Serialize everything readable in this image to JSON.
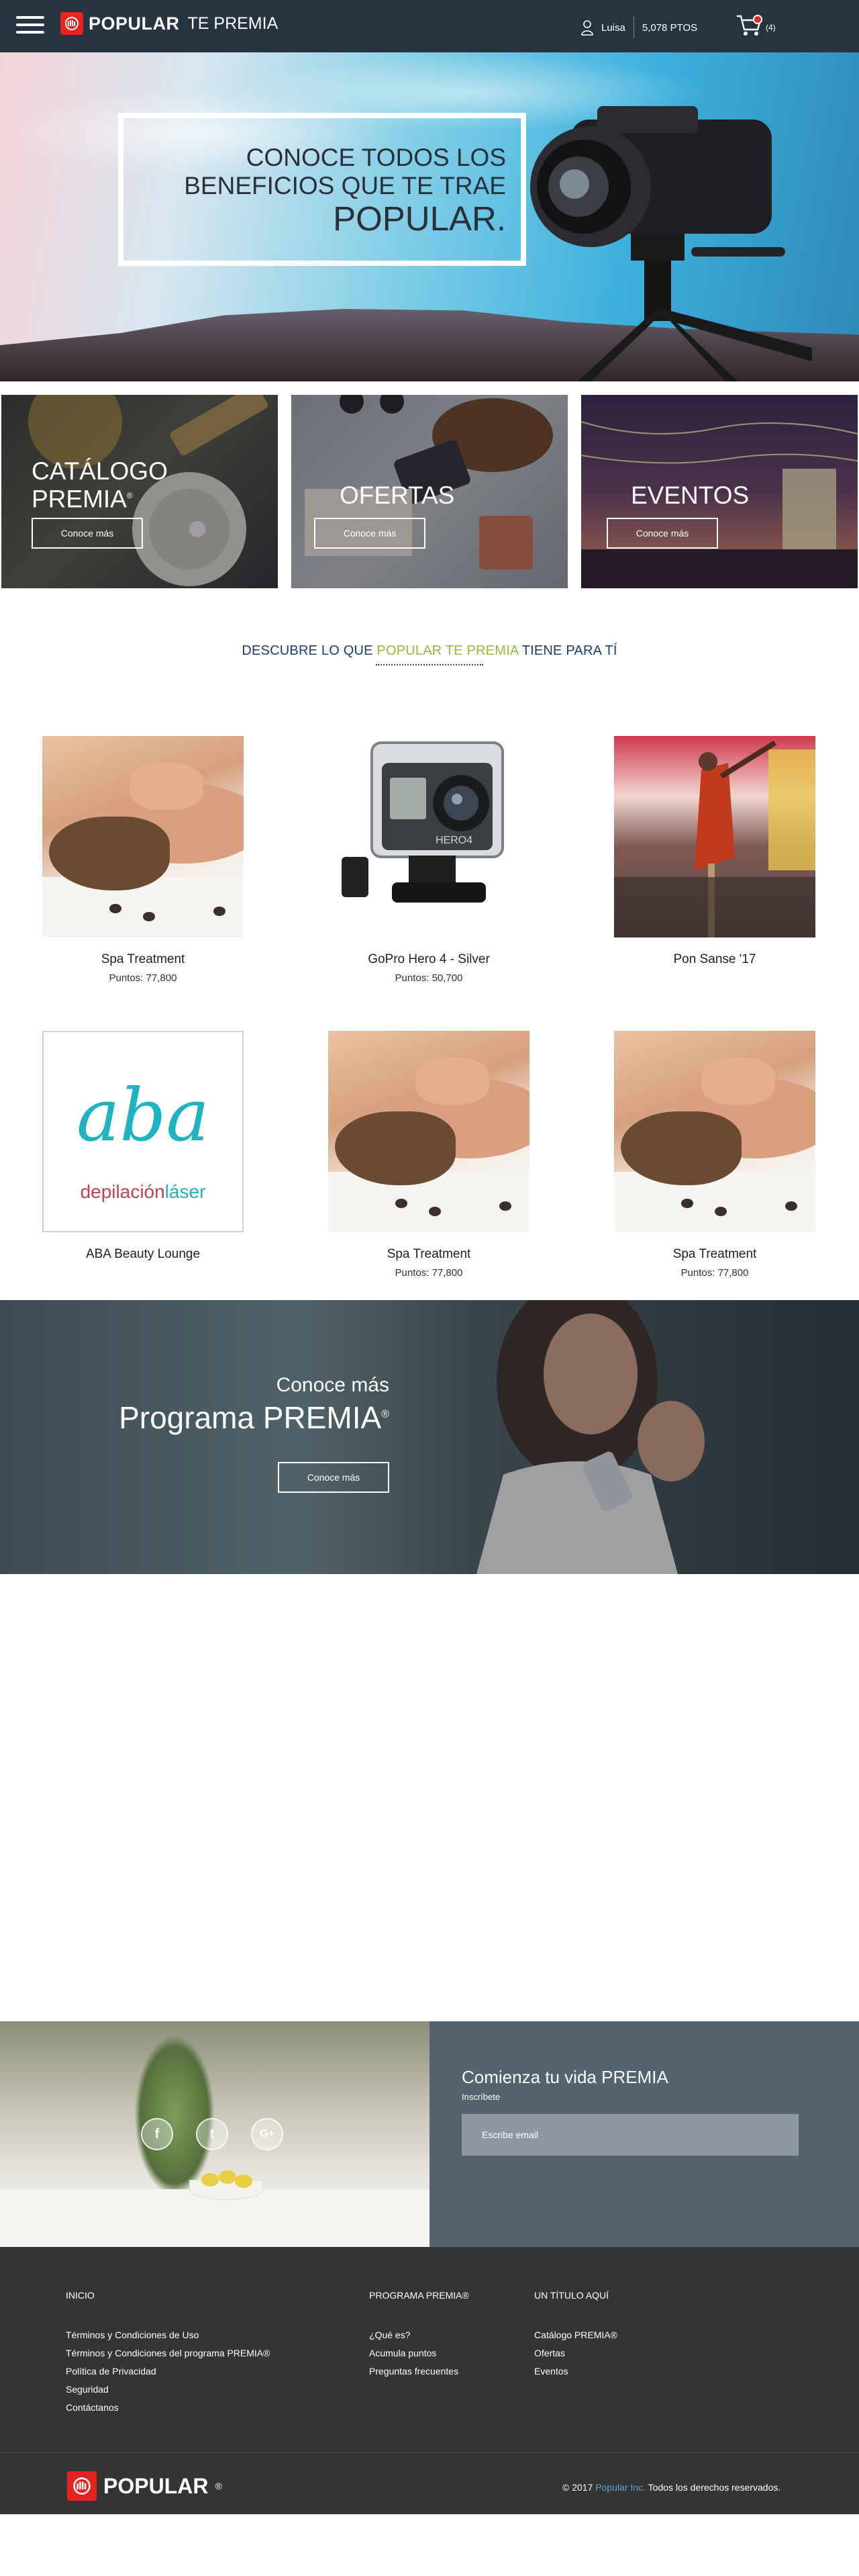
{
  "header": {
    "logo_text": "POPULAR",
    "logo_sub": "TE PREMIA",
    "user_name": "Luisa",
    "points": "5,078 PTOS",
    "cart_count": "(4)"
  },
  "hero": {
    "line1": "CONOCE TODOS LOS",
    "line2": "BENEFICIOS QUE TE TRAE",
    "line3": "POPULAR."
  },
  "categories": [
    {
      "title_line1": "CATÁLOGO",
      "title_line2": "PREMIA",
      "mark": "®",
      "button": "Conoce más"
    },
    {
      "title_line1": "OFERTAS",
      "button": "Conoce más"
    },
    {
      "title_line1": "EVENTOS",
      "button": "Conoce más"
    }
  ],
  "discover": {
    "part1": "DESCUBRE LO QUE ",
    "part2": "POPULAR TE PREMIA",
    "part3": " TIENE PARA TÍ"
  },
  "products": [
    {
      "name": "Spa Treatment",
      "points": "Puntos: 77,800"
    },
    {
      "name": "GoPro Hero 4 - Silver",
      "points": "Puntos: 50,700"
    },
    {
      "name": "Pon Sanse '17",
      "points": ""
    },
    {
      "name": "ABA Beauty Lounge",
      "points": "",
      "logo_line1": "aba",
      "logo_line2a": "depilación",
      "logo_line2b": "láser"
    },
    {
      "name": "Spa Treatment",
      "points": "Puntos: 77,800"
    },
    {
      "name": "Spa Treatment",
      "points": "Puntos: 77,800"
    }
  ],
  "gopro_label": "HERO4",
  "promo": {
    "sub": "Conoce más",
    "title": "Programa PREMIA",
    "mark": "®",
    "button": "Conoce más"
  },
  "subscribe": {
    "social": [
      "f",
      "t",
      "G+"
    ],
    "title": "Comienza tu vida PREMIA",
    "label": "Inscríbete",
    "placeholder": "Escribe email"
  },
  "footer": {
    "col1": {
      "heading": "INICIO",
      "links": [
        "Términos y Condiciones de Uso",
        "Términos y Condiciones del programa PREMIA®",
        "Política de Privacidad",
        "Seguridad",
        "Contáctanos"
      ]
    },
    "col2": {
      "heading": "PROGRAMA PREMIA®",
      "links": [
        "¿Qué es?",
        "Acumula puntos",
        "Preguntas frecuentes"
      ]
    },
    "col3": {
      "heading": "UN TÍTULO AQUÍ",
      "links": [
        "Catálogo PREMIA®",
        "Ofertas",
        "Eventos"
      ]
    },
    "logo_text": "POPULAR",
    "logo_mark": "®",
    "copy_pre": "© 2017 ",
    "copy_link": "Popular Inc.",
    "copy_post": " Todos los derechos reservados."
  },
  "colors": {
    "header_bg": "#263341",
    "brand_red": "#e52320",
    "accent_green": "#96b93a",
    "title_blue": "#1b3f72",
    "footer_bg": "#343434"
  }
}
